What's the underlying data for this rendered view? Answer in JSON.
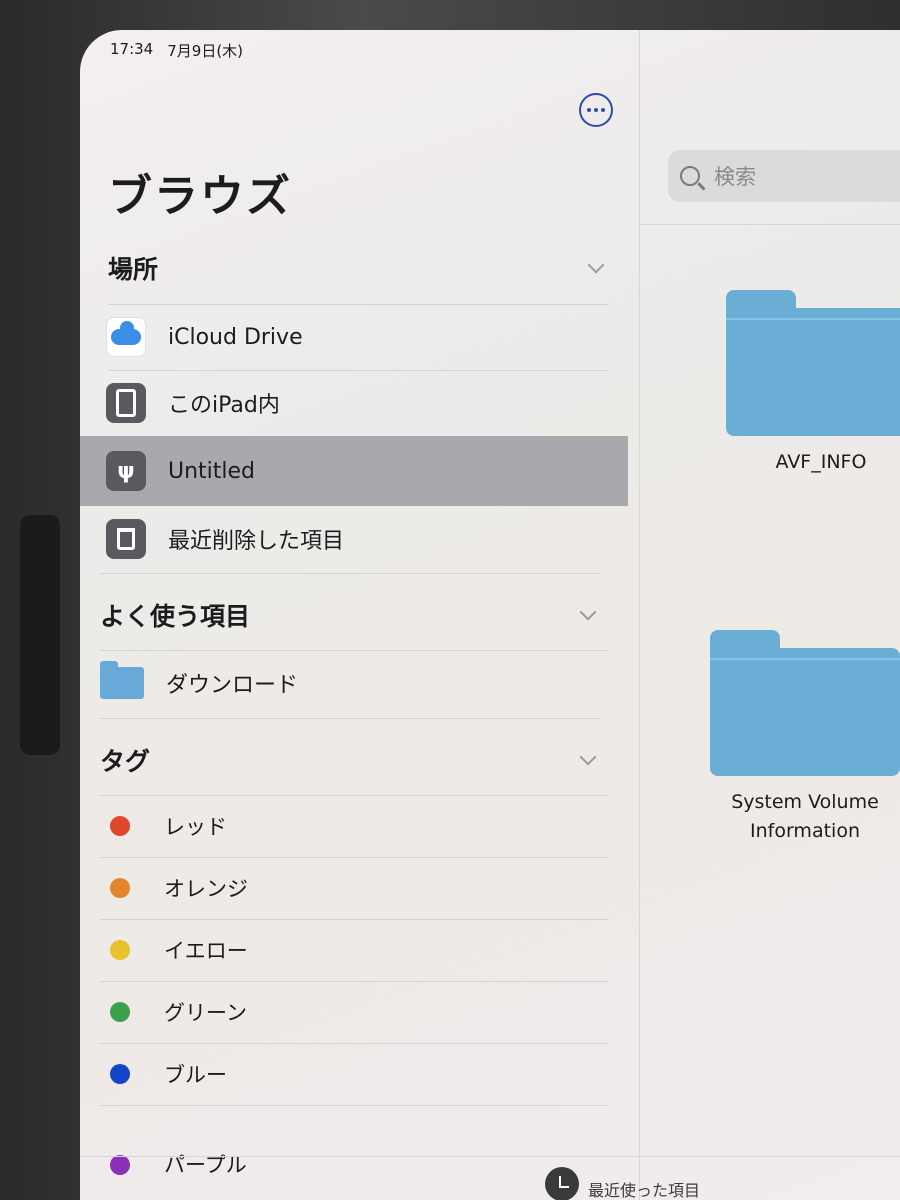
{
  "status_bar": {
    "time": "17:34",
    "date": "7月9日(木)"
  },
  "sidebar": {
    "title": "ブラウズ",
    "sections": {
      "locations": {
        "label": "場所",
        "items": [
          {
            "label": "iCloud Drive",
            "icon": "icloud-icon"
          },
          {
            "label": "このiPad内",
            "icon": "ipad-icon"
          },
          {
            "label": "Untitled",
            "icon": "usb-drive-icon",
            "selected": true
          },
          {
            "label": "最近削除した項目",
            "icon": "trash-icon"
          }
        ]
      },
      "favorites": {
        "label": "よく使う項目",
        "items": [
          {
            "label": "ダウンロード",
            "icon": "download-folder-icon"
          }
        ]
      },
      "tags": {
        "label": "タグ",
        "items": [
          {
            "label": "レッド",
            "color": "#e0452e"
          },
          {
            "label": "オレンジ",
            "color": "#e2872b"
          },
          {
            "label": "イエロー",
            "color": "#e7c22b"
          },
          {
            "label": "グリーン",
            "color": "#3aa14a"
          },
          {
            "label": "ブルー",
            "color": "#1445c9"
          },
          {
            "label": "パープル",
            "color": "#8a2fb8"
          }
        ]
      }
    }
  },
  "content": {
    "search_placeholder": "検索",
    "folders": [
      {
        "name": "AVF_INFO"
      },
      {
        "name": "System Volume Information"
      }
    ]
  },
  "bottom_bar": {
    "recents_label": "最近使った項目"
  },
  "colors": {
    "accent": "#2b4db0",
    "folder": "#6aaed6",
    "selected_row": "#a9a8ac"
  }
}
